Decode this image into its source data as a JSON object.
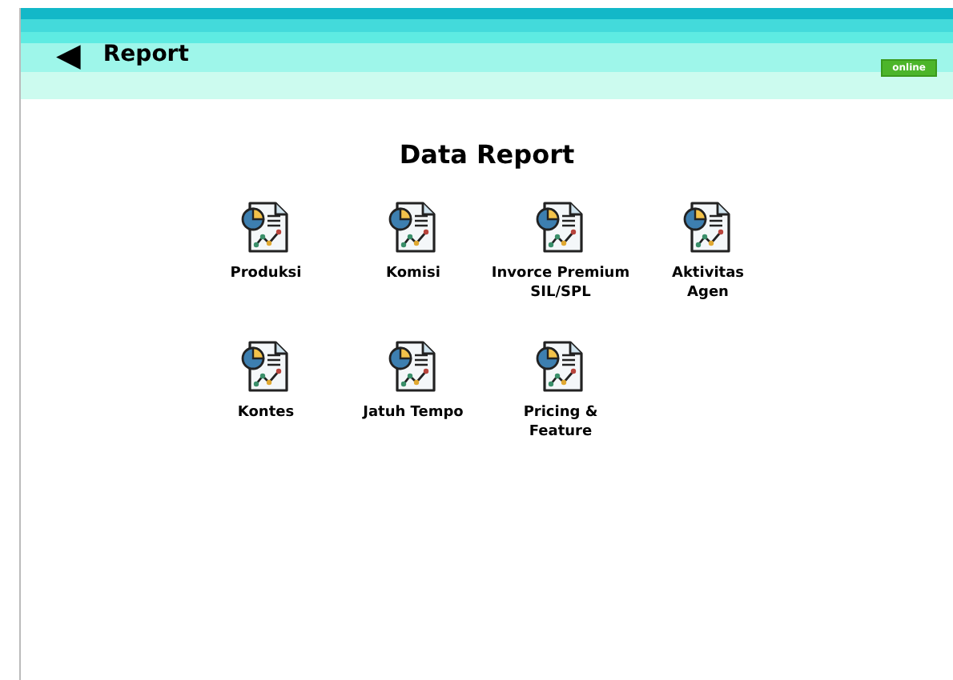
{
  "header": {
    "back": "◀",
    "title": "Report",
    "status": "online"
  },
  "heading": "Data Report",
  "reports": [
    {
      "label": "Produksi"
    },
    {
      "label": "Komisi"
    },
    {
      "label": "Invorce Premium SIL/SPL"
    },
    {
      "label": "Aktivitas Agen"
    },
    {
      "label": "Kontes"
    },
    {
      "label": "Jatuh Tempo"
    },
    {
      "label": "Pricing & Feature"
    }
  ]
}
